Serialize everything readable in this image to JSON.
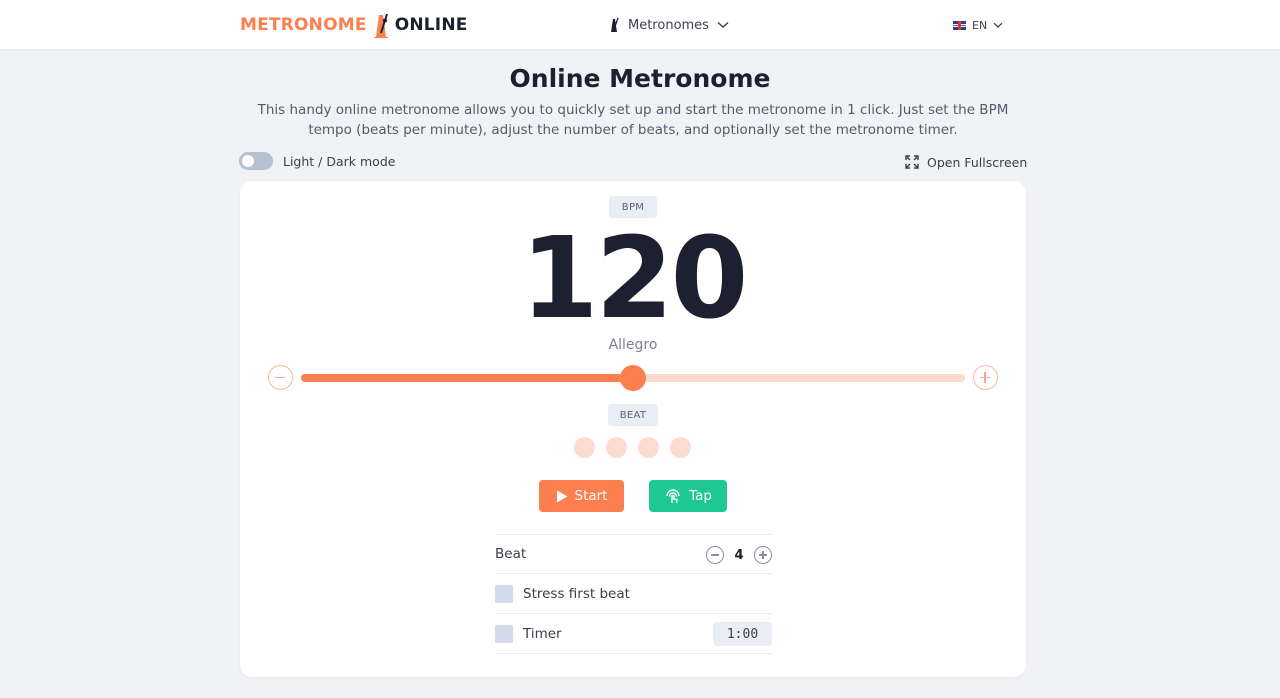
{
  "header": {
    "logo_part1": "METRONOME",
    "logo_part2": "ONLINE",
    "nav_label": "Metronomes",
    "lang_label": "EN"
  },
  "page": {
    "title": "Online Metronome",
    "description": "This handy online metronome allows you to quickly set up and start the metronome in 1 click. Just set the BPM tempo (beats per minute), adjust the number of beats, and optionally set the metronome timer.",
    "mode_toggle_label": "Light / Dark mode",
    "fullscreen_label": "Open Fullscreen"
  },
  "metronome": {
    "bpm_label": "BPM",
    "bpm_value": "120",
    "tempo_name": "Allegro",
    "slider_fraction": 0.5,
    "beat_label": "BEAT",
    "beat_count": 4,
    "start_label": "Start",
    "tap_label": "Tap"
  },
  "settings": {
    "beat_label": "Beat",
    "beat_value": "4",
    "stress_label": "Stress first beat",
    "timer_label": "Timer",
    "timer_value": "1:00"
  },
  "colors": {
    "accent": "#fb7f4f",
    "accent_light": "#fbd9cd",
    "tap": "#1dc990",
    "background": "#f1f2f6"
  },
  "icons": [
    "metronome-logo-icon",
    "metronome-icon",
    "chevron-down-icon",
    "uk-flag-icon",
    "fullscreen-icon",
    "play-icon",
    "tap-icon"
  ]
}
